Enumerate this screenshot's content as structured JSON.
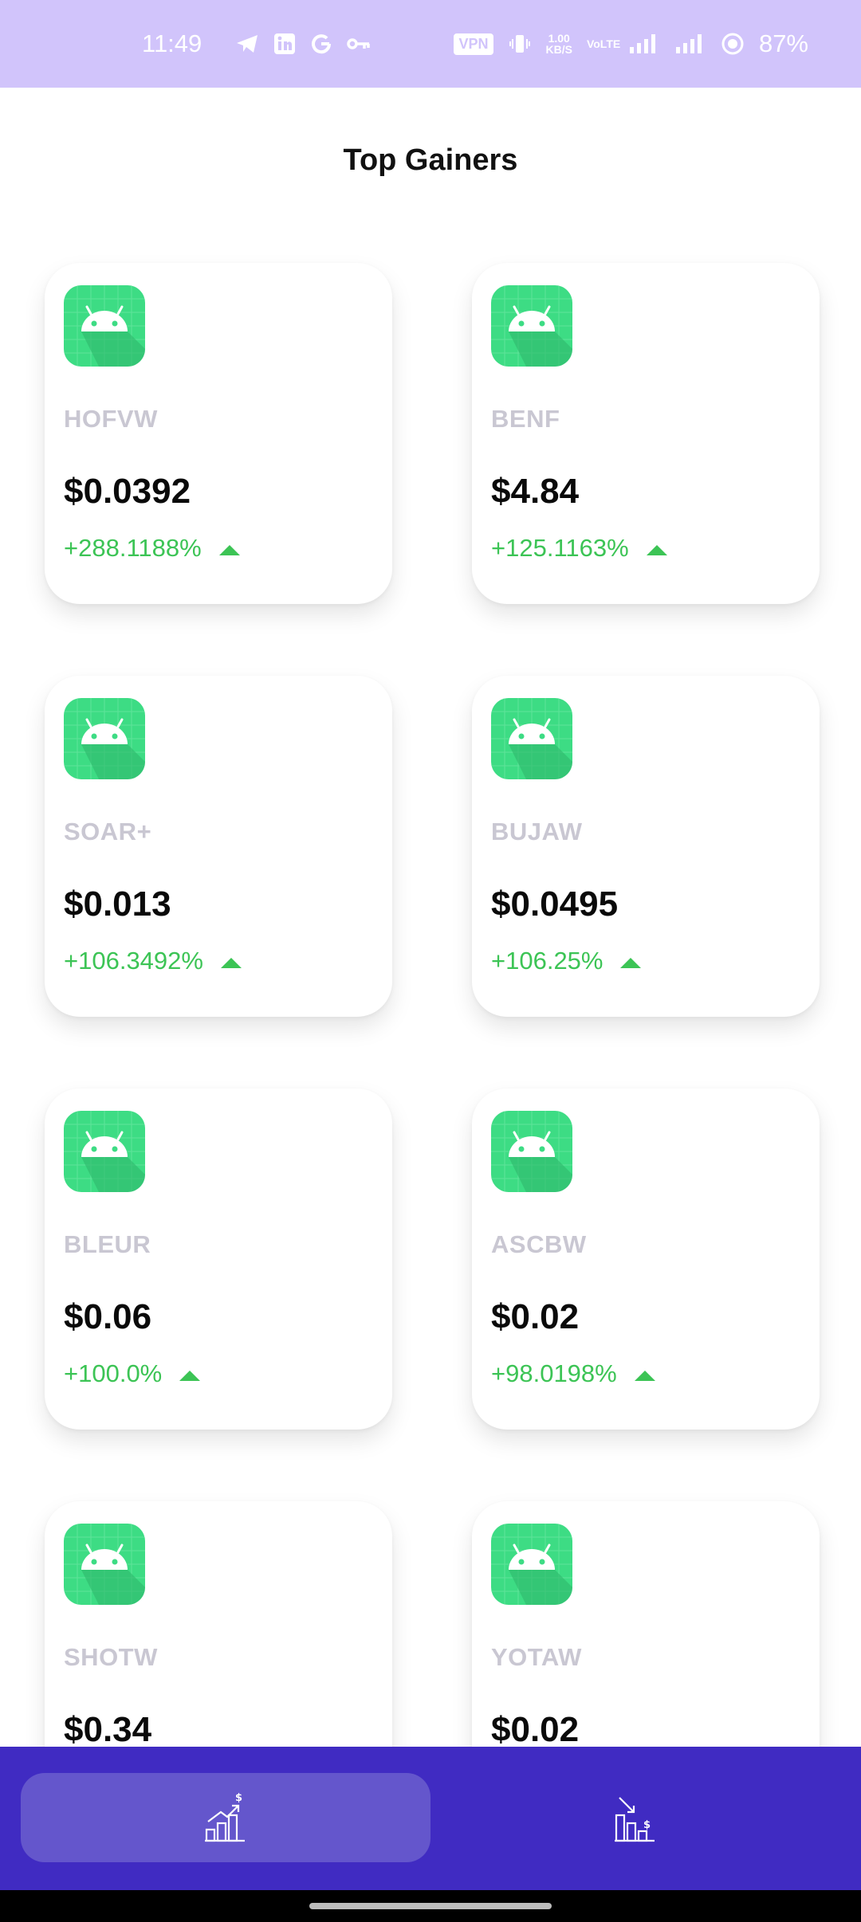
{
  "status_bar": {
    "time": "11:49",
    "vpn": "VPN",
    "speed_value": "1.00",
    "speed_unit": "KB/S",
    "volte": "VoLTE",
    "battery_pct": "87%",
    "icons": [
      "telegram-icon",
      "linkedin-icon",
      "google-icon",
      "key-icon",
      "vibrate-icon",
      "signal-icon",
      "battery-saver-icon"
    ]
  },
  "header": {
    "title": "Top Gainers"
  },
  "cards": [
    {
      "symbol": "HOFVW",
      "price": "$0.0392",
      "change": "+288.1188%"
    },
    {
      "symbol": "BENF",
      "price": "$4.84",
      "change": "+125.1163%"
    },
    {
      "symbol": "SOAR+",
      "price": "$0.013",
      "change": "+106.3492%"
    },
    {
      "symbol": "BUJAW",
      "price": "$0.0495",
      "change": "+106.25%"
    },
    {
      "symbol": "BLEUR",
      "price": "$0.06",
      "change": "+100.0%"
    },
    {
      "symbol": "ASCBW",
      "price": "$0.02",
      "change": "+98.0198%"
    },
    {
      "symbol": "SHOTW",
      "price": "$0.34",
      "change": ""
    },
    {
      "symbol": "YOTAW",
      "price": "$0.02",
      "change": ""
    }
  ],
  "bottom_nav": {
    "items": [
      {
        "icon": "gainers-chart-icon",
        "active": true
      },
      {
        "icon": "losers-chart-icon",
        "active": false
      }
    ]
  },
  "colors": {
    "status_bar_bg": "#d1c4fb",
    "nav_bg": "#402bc2",
    "nav_active_bg": "#6456cc",
    "gain_green": "#3cc455",
    "icon_green": "#3ddc84"
  }
}
